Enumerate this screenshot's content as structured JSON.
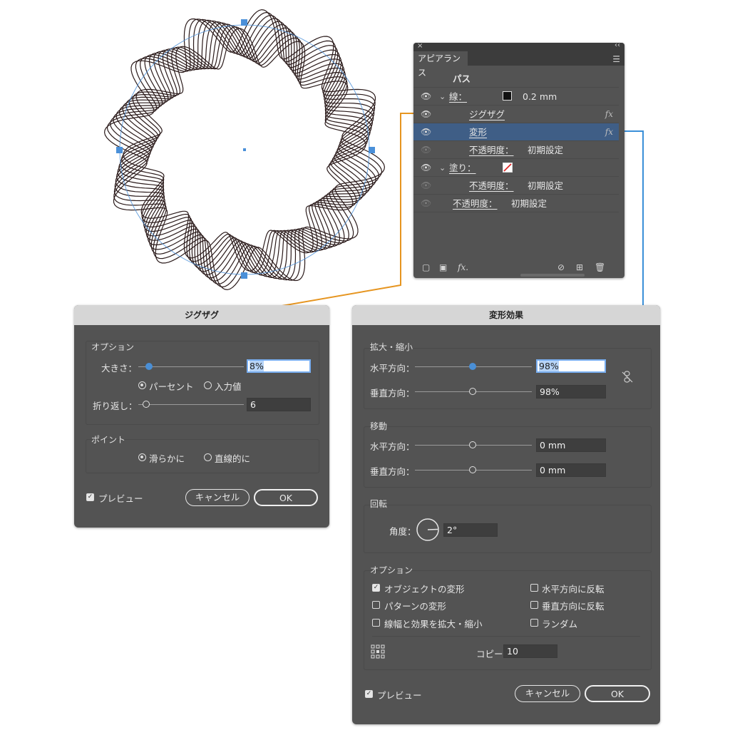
{
  "colors": {
    "orange_connector": "#e69520",
    "blue_connector": "#3a8fd8",
    "panel_bg": "#535353",
    "selection": "#3f5e86"
  },
  "appearance_panel": {
    "tab_title": "アピアランス",
    "object_label": "パス",
    "rows": [
      {
        "label": "線：",
        "value": "0.2 mm",
        "swatch": "black-stroke"
      },
      {
        "label": "ジグザグ",
        "fx": "fx"
      },
      {
        "label": "変形",
        "fx": "fx",
        "selected": true
      },
      {
        "label": "不透明度：",
        "value": "初期設定"
      },
      {
        "label": "塗り：",
        "swatch": "none-fill"
      },
      {
        "label": "不透明度：",
        "value": "初期設定"
      },
      {
        "label": "不透明度：",
        "value": "初期設定"
      }
    ],
    "footer_icons": [
      "new-stroke-icon",
      "new-fill-icon",
      "fx-icon",
      "clear-icon",
      "duplicate-icon",
      "trash-icon"
    ]
  },
  "zigzag_dialog": {
    "title": "ジグザグ",
    "options_label": "オプション",
    "size_label": "大きさ：",
    "size_value": "8%",
    "size_fraction": 0.08,
    "radio_percent": "パーセント",
    "radio_absolute": "入力値",
    "ridges_label": "折り返し：",
    "ridges_value": "6",
    "points_label": "ポイント",
    "radio_smooth": "滑らかに",
    "radio_corner": "直線的に",
    "preview_label": "プレビュー",
    "cancel_label": "キャンセル",
    "ok_label": "OK"
  },
  "transform_dialog": {
    "title": "変形効果",
    "scale_label": "拡大・縮小",
    "scale_h_label": "水平方向：",
    "scale_h_value": "98%",
    "scale_v_label": "垂直方向：",
    "scale_v_value": "98%",
    "move_label": "移動",
    "move_h_label": "水平方向：",
    "move_h_value": "0 mm",
    "move_v_label": "垂直方向：",
    "move_v_value": "0 mm",
    "rotate_label": "回転",
    "angle_label": "角度：",
    "angle_value": "2°",
    "options_label": "オプション",
    "opt_transform_objects": "オブジェクトの変形",
    "opt_transform_patterns": "パターンの変形",
    "opt_scale_strokes": "線幅と効果を拡大・縮小",
    "opt_reflect_x": "水平方向に反転",
    "opt_reflect_y": "垂直方向に反転",
    "opt_random": "ランダム",
    "copies_label": "コピー",
    "copies_value": "10",
    "preview_label": "プレビュー",
    "cancel_label": "キャンセル",
    "ok_label": "OK"
  }
}
